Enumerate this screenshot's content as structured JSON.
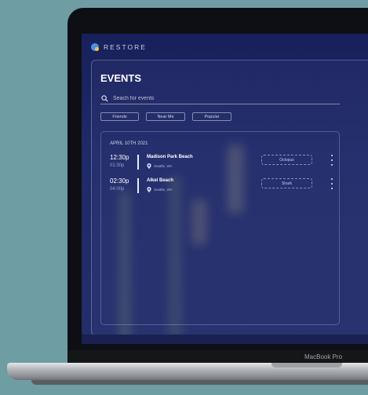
{
  "app": {
    "brand": "RESTORE"
  },
  "page": {
    "title": "EVENTS"
  },
  "search": {
    "placeholder": "Seach for events"
  },
  "filters": [
    "Friends",
    "Near Me",
    "Popular"
  ],
  "events": {
    "date": "APRIL 10TH 2021",
    "items": [
      {
        "start": "12:30p",
        "end": "01:30p",
        "name": "Madison Park Beach",
        "location": "Seattle, WA",
        "tag": "Octopus"
      },
      {
        "start": "02:30p",
        "end": "04:00p",
        "name": "Alkei Beach",
        "location": "Seattle, WA",
        "tag": "Shark"
      }
    ]
  },
  "device": {
    "model": "MacBook Pro"
  },
  "icons": {
    "logo": "restore-logo-icon",
    "search": "search-icon",
    "pin": "location-pin-icon",
    "more": "more-vertical-icon"
  }
}
